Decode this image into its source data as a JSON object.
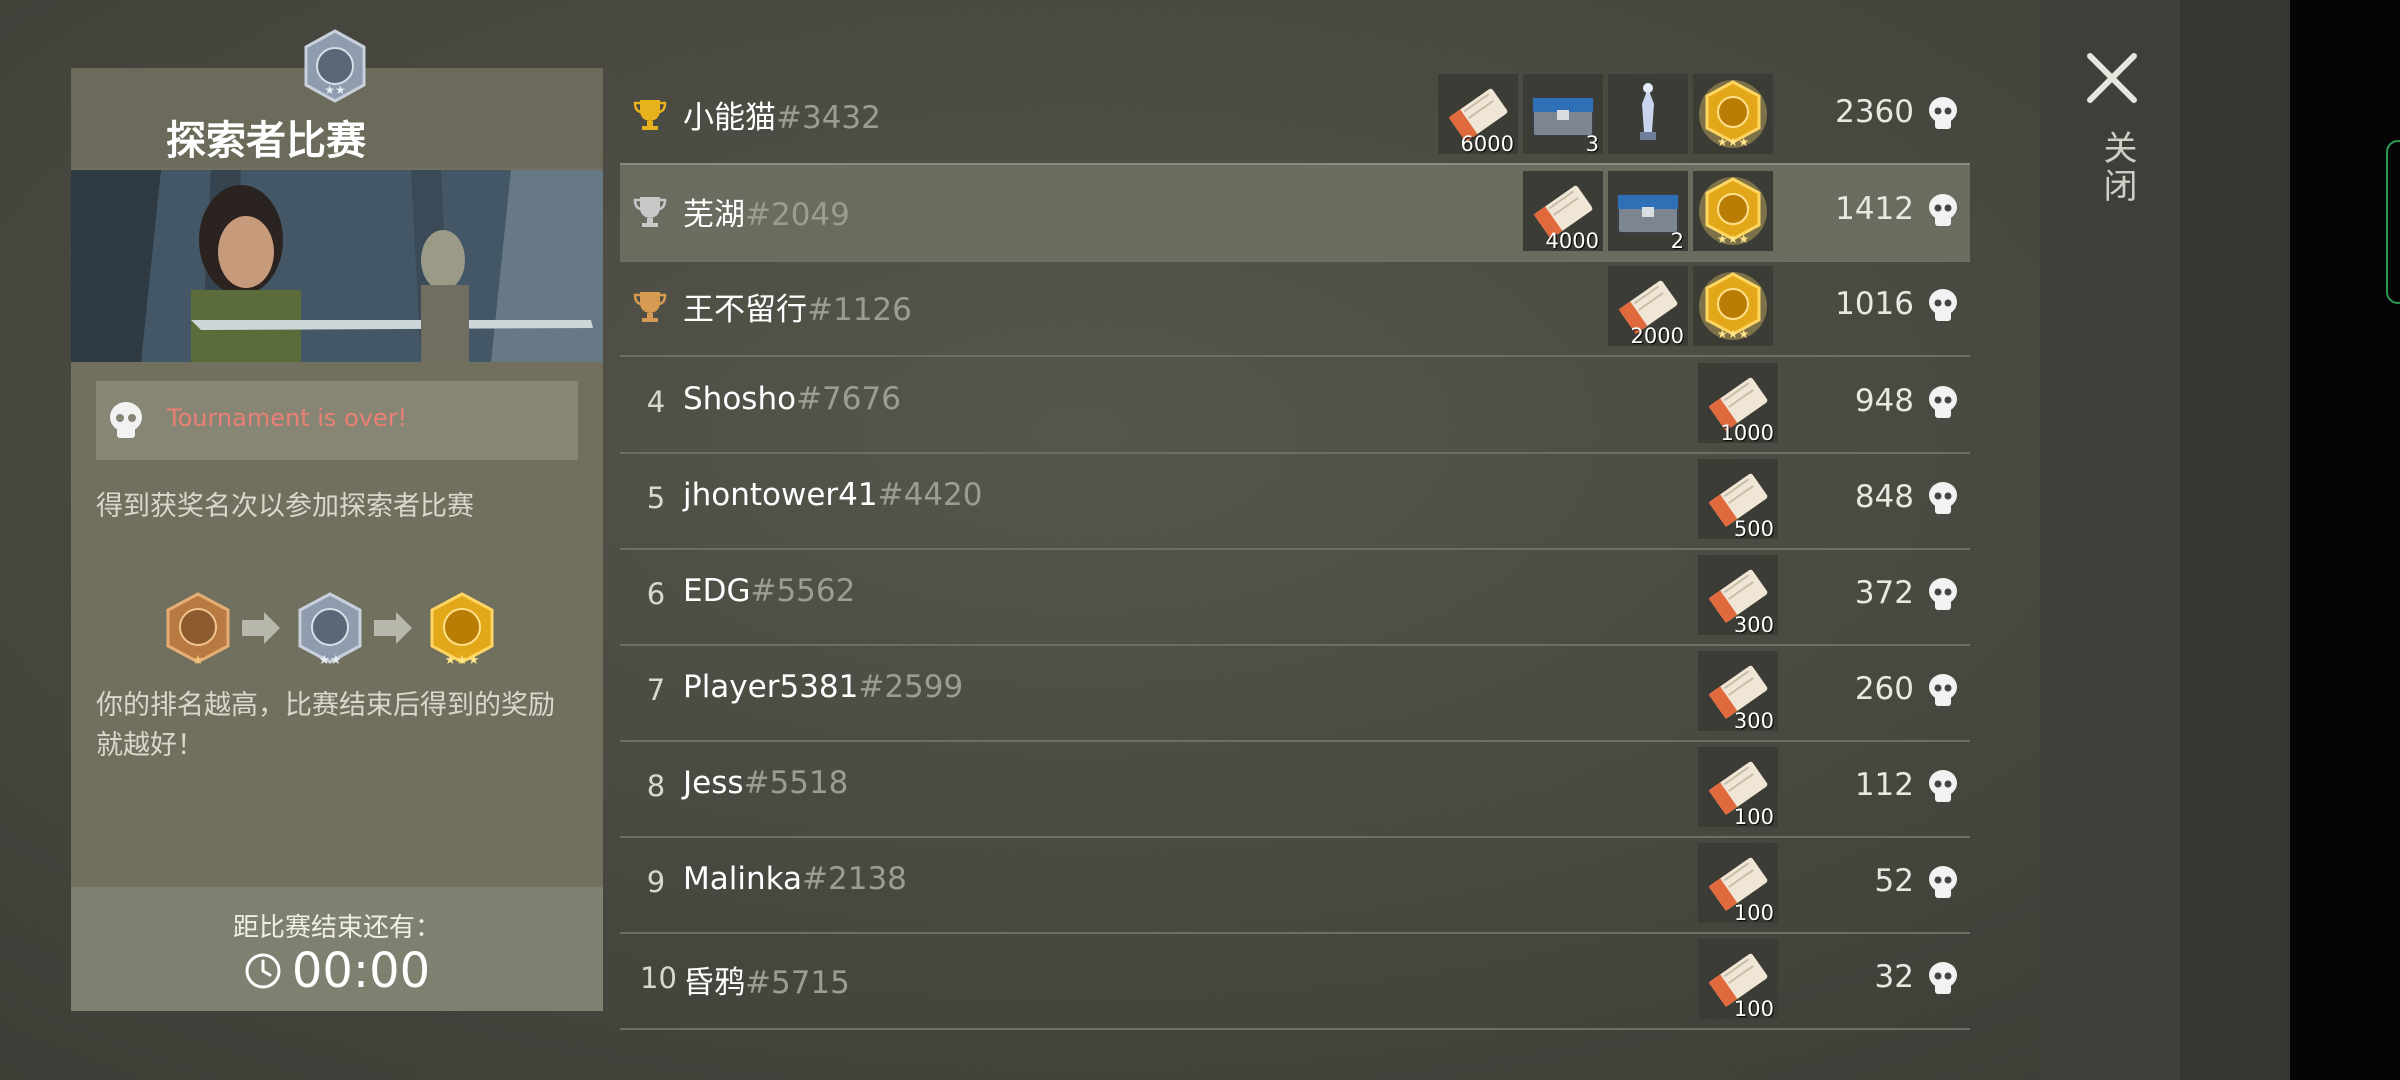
{
  "panel": {
    "title": "探索者比赛",
    "status": "Tournament is over!",
    "description": "得到获奖名次以参加探索者比赛",
    "reward_hint": "你的排名越高，比赛结束后得到的奖励就越好！",
    "countdown_label": "距比赛结束还有：",
    "countdown_value": "00:00"
  },
  "close": {
    "label": "关闭",
    "icon": "close-icon"
  },
  "colors": {
    "gold": "#e8b21c",
    "silver": "#c8c8c8",
    "bronze": "#d69a52",
    "status_red": "#ea8076"
  },
  "leaderboard": [
    {
      "rank": "1",
      "trophy": "gold",
      "name": "小能猫",
      "tag": "#3432",
      "score": "2360",
      "tickets": "6000",
      "crates": "3",
      "statue": true,
      "medal": true
    },
    {
      "rank": "2",
      "trophy": "silver",
      "name": "芜湖",
      "tag": "#2049",
      "score": "1412",
      "tickets": "4000",
      "crates": "2",
      "statue": false,
      "medal": true
    },
    {
      "rank": "3",
      "trophy": "bronze",
      "name": "王不留行",
      "tag": "#1126",
      "score": "1016",
      "tickets": "2000",
      "crates": "",
      "statue": false,
      "medal": true
    },
    {
      "rank": "4",
      "name": "Shosho",
      "tag": "#7676",
      "score": "948",
      "tickets": "1000"
    },
    {
      "rank": "5",
      "name": "jhontower41",
      "tag": "#4420",
      "score": "848",
      "tickets": "500"
    },
    {
      "rank": "6",
      "name": "EDG",
      "tag": "#5562",
      "score": "372",
      "tickets": "300"
    },
    {
      "rank": "7",
      "name": "Player5381",
      "tag": "#2599",
      "score": "260",
      "tickets": "300"
    },
    {
      "rank": "8",
      "name": "Jess",
      "tag": "#5518",
      "score": "112",
      "tickets": "100"
    },
    {
      "rank": "9",
      "name": "Malinka",
      "tag": "#2138",
      "score": "52",
      "tickets": "100"
    },
    {
      "rank": "10",
      "name": "昏鸦",
      "tag": "#5715",
      "score": "32",
      "tickets": "100"
    }
  ]
}
